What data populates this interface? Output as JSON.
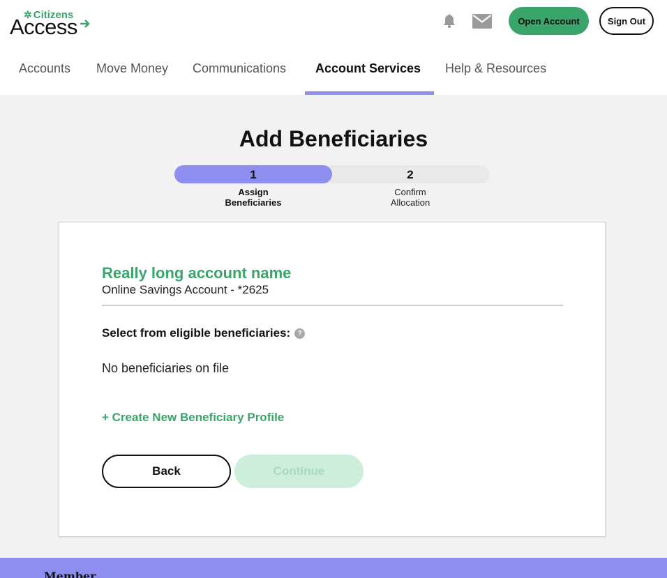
{
  "brand": {
    "small": "Citizens",
    "big": "Access",
    "color": "#3aa56b"
  },
  "header": {
    "bell_icon": "bell-icon",
    "mail_icon": "mail-icon",
    "open_account_label": "Open Account",
    "sign_out_label": "Sign Out"
  },
  "nav": {
    "items": [
      {
        "label": "Accounts"
      },
      {
        "label": "Move Money"
      },
      {
        "label": "Communications"
      },
      {
        "label": "Account Services",
        "active": true
      },
      {
        "label": "Help & Resources"
      }
    ],
    "accent": "#8d8ef0"
  },
  "page": {
    "title": "Add Beneficiaries"
  },
  "stepper": {
    "steps": [
      {
        "number": "1",
        "label_line1": "Assign",
        "label_line2": "Beneficiaries",
        "active": true
      },
      {
        "number": "2",
        "label_line1": "Confirm",
        "label_line2": "Allocation",
        "active": false
      }
    ],
    "progress_fraction": 0.5
  },
  "card": {
    "account_name": "Really long account name",
    "account_sub": "Online Savings Account - *2625",
    "select_label": "Select from eligible beneficiaries:",
    "help_icon": "question-icon",
    "help_glyph": "?",
    "empty_text": "No beneficiaries on file",
    "create_link": "+ Create New Beneficiary Profile",
    "back_label": "Back",
    "continue_label": "Continue"
  },
  "footer": {
    "text": "Member"
  }
}
